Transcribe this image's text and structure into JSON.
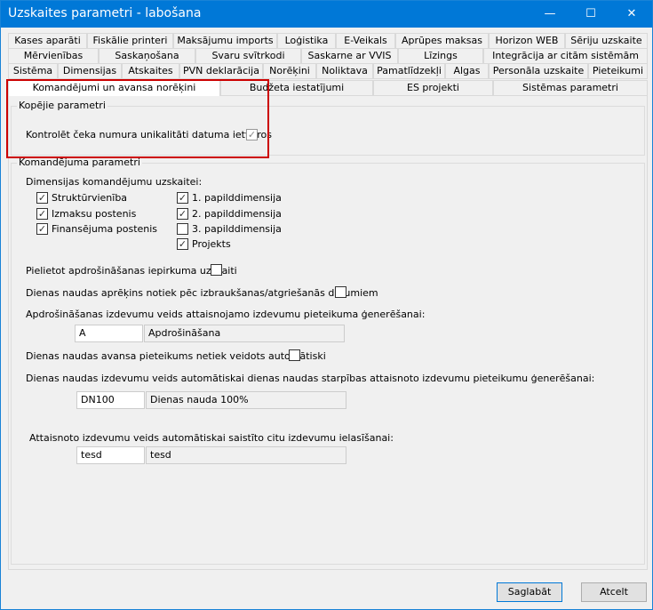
{
  "window": {
    "title": "Uzskaites parametri - labošana",
    "minimize": "—",
    "maximize": "☐",
    "close": "✕"
  },
  "tabs": {
    "row1": [
      "Kases aparāti",
      "Fiskālie printeri",
      "Maksājumu imports",
      "Loģistika",
      "E-Veikals",
      "Aprūpes maksas",
      "Horizon WEB",
      "Sēriju uzskaite"
    ],
    "row2": [
      "Mērvienības",
      "Saskaņošana",
      "Svaru svītrkodi",
      "Saskarne ar VVIS",
      "Līzings",
      "Integrācija ar citām sistēmām"
    ],
    "row3": [
      "Sistēma",
      "Dimensijas",
      "Atskaites",
      "PVN deklarācija",
      "Norēķini",
      "Noliktava",
      "Pamatlīdzekļi",
      "Algas",
      "Personāla uzskaite",
      "Pieteikumi"
    ],
    "row4": [
      "Komandējumi un avansa norēķini",
      "Budžeta iestatījumi",
      "ES projekti",
      "Sistēmas parametri"
    ]
  },
  "common": {
    "title": "Kopējie parametri",
    "check_label": "Kontrolēt čeka numura unikalitāti datuma ietvaros",
    "checked": true
  },
  "trip": {
    "title": "Komandējuma parametri",
    "dims_label": "Dimensijas komandējumu uzskaitei:",
    "dims": [
      {
        "label": "Struktūrvienība",
        "checked": true
      },
      {
        "label": "Izmaksu postenis",
        "checked": true
      },
      {
        "label": "Finansējuma postenis",
        "checked": true
      },
      {
        "label": "1. papilddimensija",
        "checked": true
      },
      {
        "label": "2. papilddimensija",
        "checked": true
      },
      {
        "label": "3. papilddimensija",
        "checked": false
      },
      {
        "label": "Projekts",
        "checked": true
      }
    ],
    "insurance_label": "Pielietot apdrošināšanas iepirkuma uzskaiti",
    "per_diem_label": "Dienas naudas aprēķins notiek pēc izbraukšanas/atgriešanās datumiem",
    "ins_type_label": "Apdrošināšanas izdevumu veids attaisnojamo izdevumu pieteikuma ģenerēšanai:",
    "ins_code": "A",
    "ins_name": "Apdrošināšana",
    "advance_label": "Dienas naudas avansa pieteikums netiek veidots automātiski",
    "diff_label": "Dienas naudas izdevumu veids automātiskai dienas naudas starpības attaisnoto izdevumu pieteikumu ģenerēšanai:",
    "diff_code": "DN100",
    "diff_name": "Dienas nauda 100%",
    "other_label": "Attaisnoto izdevumu veids automātiskai saistīto citu izdevumu ielasīšanai:",
    "other_code": "tesd",
    "other_name": "tesd"
  },
  "buttons": {
    "save": "Saglabāt",
    "cancel": "Atcelt"
  },
  "check_glyph": "✓"
}
